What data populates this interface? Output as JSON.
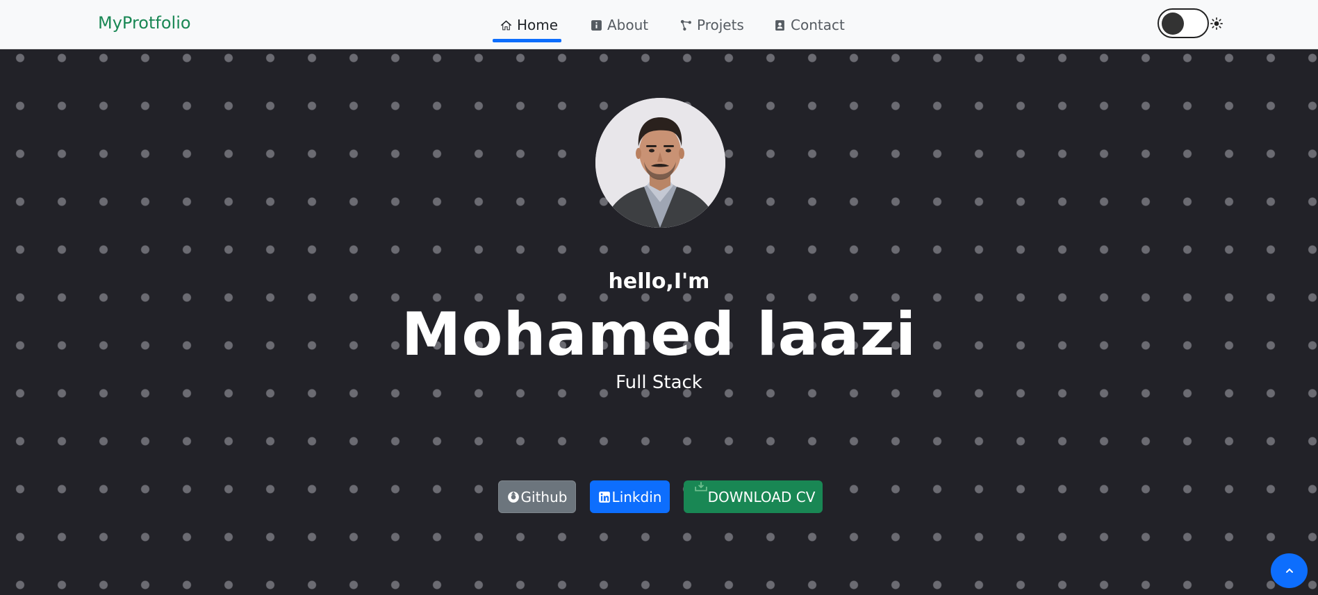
{
  "navbar": {
    "brand": "MyProtfolio",
    "items": [
      {
        "label": "Home",
        "icon": "home-icon",
        "active": true
      },
      {
        "label": "About",
        "icon": "info-icon",
        "active": false
      },
      {
        "label": "Projets",
        "icon": "nodes-icon",
        "active": false
      },
      {
        "label": "Contact",
        "icon": "contact-card-icon",
        "active": false
      }
    ],
    "theme_toggle": {
      "state": "dark",
      "icon": "sun-icon"
    }
  },
  "hero": {
    "greeting": "hello,I'm",
    "name": "Mohamed laazi",
    "role": "Full Stack",
    "avatar": "profile-photo",
    "buttons": {
      "github": "Github",
      "linkedin": "Linkdin",
      "download_cv": "DOWNLOAD CV"
    }
  },
  "scroll_top": {
    "icon": "chevron-up-icon"
  },
  "colors": {
    "brand": "#198754",
    "primary": "#0d6efd",
    "secondary": "#6c757d",
    "success": "#198754",
    "hero_bg": "#222228",
    "navbar_bg": "#f8f9fa"
  }
}
